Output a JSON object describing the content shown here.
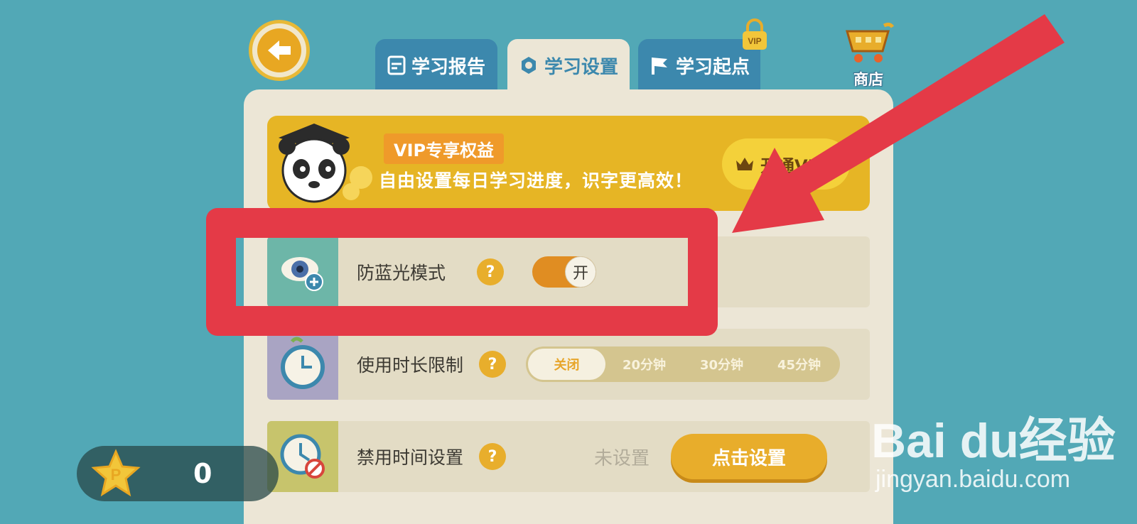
{
  "tabs": [
    {
      "label": "学习报告",
      "icon": "report-icon",
      "active": false
    },
    {
      "label": "学习设置",
      "icon": "gear-icon",
      "active": true
    },
    {
      "label": "学习起点",
      "icon": "flag-icon",
      "active": false
    }
  ],
  "vip_lock_label": "VIP",
  "shop": {
    "label": "商店",
    "icon": "cart-icon"
  },
  "banner": {
    "tag": "VIP专享权益",
    "text": "自由设置每日学习进度，识字更高效！",
    "button": "开通VIP"
  },
  "rows": {
    "blue_light": {
      "label": "防蓝光模式",
      "toggle_state": "开",
      "help": "?"
    },
    "time_limit": {
      "label": "使用时长限制",
      "help": "?",
      "options": [
        "关闭",
        "20分钟",
        "30分钟",
        "45分钟"
      ],
      "selected": "关闭"
    },
    "forbid_time": {
      "label": "禁用时间设置",
      "help": "?",
      "status": "未设置",
      "button": "点击设置"
    }
  },
  "points": {
    "value": "0",
    "icon": "star-p-icon"
  },
  "watermark": {
    "logo": "Bai du经验",
    "url": "jingyan.baidu.com"
  },
  "colors": {
    "background": "#52a8b6",
    "accent": "#e8ad2b",
    "tab_blue": "#3c88ad",
    "annotation_red": "#e43a47"
  }
}
